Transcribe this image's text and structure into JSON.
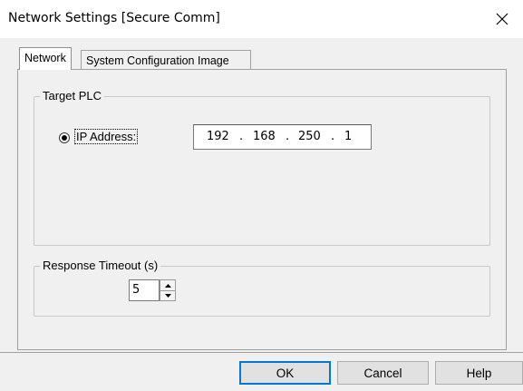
{
  "window": {
    "title": "Network Settings [Secure Comm]",
    "close_icon": "close-icon"
  },
  "tabs": [
    {
      "label": "Network",
      "active": true
    },
    {
      "label": "System Configuration Image",
      "active": false
    }
  ],
  "target_plc": {
    "legend": "Target PLC",
    "ip_radio_label": "IP Address:",
    "ip_radio_selected": true,
    "ip_octets": [
      "192",
      "168",
      "250",
      "1"
    ],
    "ip_separator": "."
  },
  "response_timeout": {
    "legend": "Response Timeout (s)",
    "value": "5"
  },
  "buttons": {
    "ok": "OK",
    "cancel": "Cancel",
    "help": "Help"
  }
}
